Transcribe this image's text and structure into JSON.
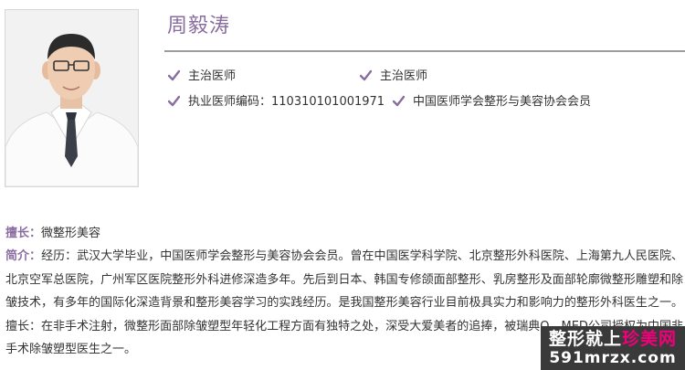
{
  "doctor": {
    "name": "周毅涛",
    "info": [
      {
        "icon": "checkmark-icon",
        "text": "主治医师"
      },
      {
        "icon": "checkmark-icon",
        "text": "主治医师"
      },
      {
        "icon": "checkmark-icon",
        "text": "执业医师编码：110310101001971"
      },
      {
        "icon": "checkmark-icon",
        "text": "中国医师学会整形与美容协会会员"
      }
    ]
  },
  "specialty": {
    "label": "擅长：",
    "value": "微整形美容"
  },
  "bio": {
    "label": "简介：",
    "text": "经历：武汉大学毕业，中国医师学会整形与美容协会会员。曾在中国医学科学院、北京整形外科医院、上海第九人民医院、北京空军总医院，广州军区医院整形外科进修深造多年。先后到日本、韩国专修颌面部整形、乳房整形及面部轮廓微整形雕塑和除皱技术，有多年的国际化深造背景和整形美容学习的实践经历。是我国整形美容行业目前极具实力和影响力的整形外科医生之一。擅长：在非手术注射，微整形面部除皱塑型年轻化工程方面有独特之处，深受大爱美者的追捧，被瑞典Q—MED公司授权为中国非手术除皱塑型医生之一。"
  },
  "watermark": {
    "part1": "整形就上",
    "part2": "珍美网",
    "line2": "591mrzx.com"
  },
  "colors": {
    "accent": "#8a6d9f",
    "watermark_bg": "#3a3a3a",
    "watermark_highlight": "#f0007a"
  }
}
